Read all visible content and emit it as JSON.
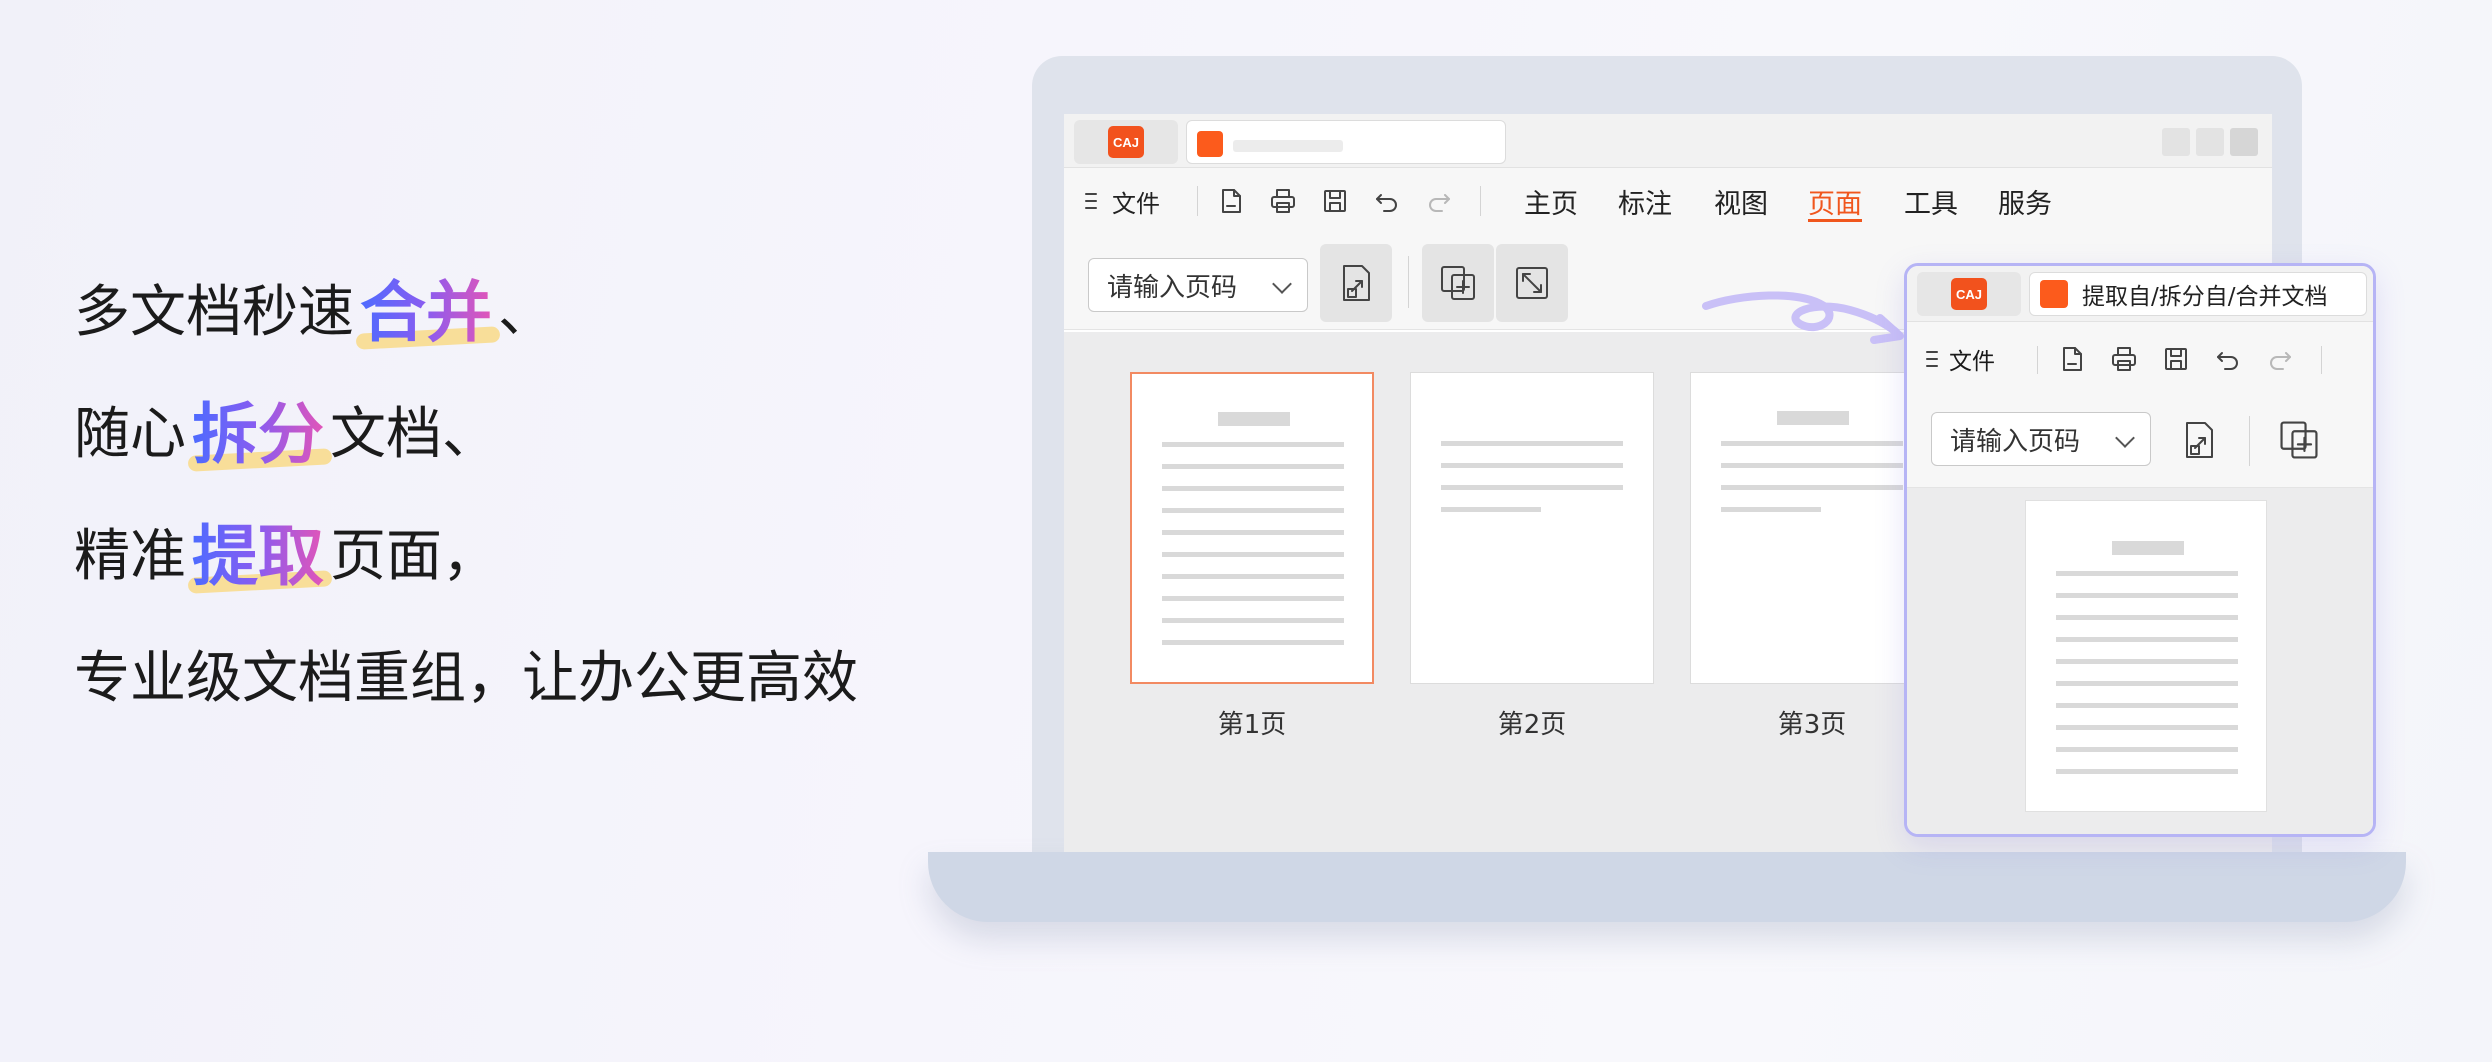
{
  "headline": {
    "line1": {
      "pre": "多文档秒速",
      "hl": "合并",
      "post": "、"
    },
    "line2": {
      "pre": "随心",
      "hl": "拆分",
      "post": "文档、"
    },
    "line3": {
      "pre": "精准",
      "hl": "提取",
      "post": "页面，"
    },
    "line4": "专业级文档重组，让办公更高效"
  },
  "app": {
    "logo_text": "CAJ",
    "menu": {
      "file": "文件",
      "items": [
        "主页",
        "标注",
        "视图",
        "页面",
        "工具",
        "服务"
      ],
      "active_index": 3
    },
    "toolbar": {
      "page_input_placeholder": "请输入页码"
    },
    "thumbnails": [
      {
        "label": "第1页",
        "selected": true
      },
      {
        "label": "第2页",
        "selected": false
      },
      {
        "label": "第3页",
        "selected": false
      }
    ]
  },
  "popup": {
    "logo_text": "CAJ",
    "tab_title": "提取自/拆分自/合并文档",
    "file": "文件",
    "page_input_placeholder": "请输入页码"
  },
  "colors": {
    "accent": "#f0561d",
    "popup_border": "#b6b4f5",
    "highlight_gradient": [
      "#4d6bff",
      "#8a5cf0",
      "#e255b8"
    ],
    "underline": "#f8dc8e"
  }
}
